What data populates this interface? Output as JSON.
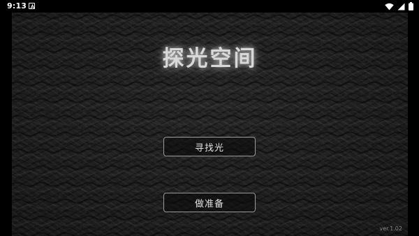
{
  "status_bar": {
    "time": "9:13",
    "icons": [
      "notification-a-icon",
      "wifi-icon",
      "signal-icon",
      "battery-icon"
    ]
  },
  "game": {
    "title": "探光空间",
    "buttons": {
      "find_light": "寻找光",
      "prepare": "做准备"
    },
    "version": "ver.1.02"
  },
  "colors": {
    "background": "#1c1c1c",
    "letterbox": "#000000",
    "title": "#d8d8d8",
    "button_border": "#9a9a9a",
    "button_text": "#e4e4e4",
    "version_text": "#8a8a8a"
  }
}
